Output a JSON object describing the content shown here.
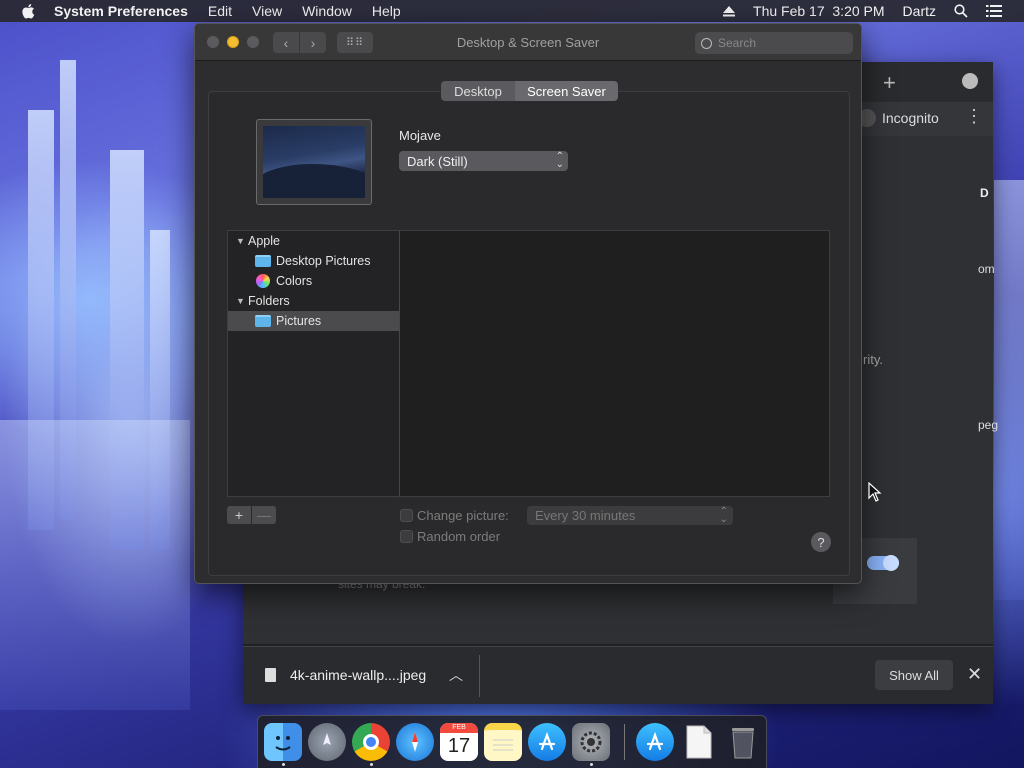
{
  "menubar": {
    "app_name": "System Preferences",
    "items": [
      "Edit",
      "View",
      "Window",
      "Help"
    ],
    "datetime": "Thu Feb 17  3:20 PM",
    "user": "Dartz"
  },
  "browser": {
    "profile_label": "Incognito",
    "cut_text_d": "D",
    "cut_text_com": "om",
    "cut_text_rity": "rity.",
    "cut_text_jpeg": "peg",
    "cut_text_sites": "sites may break.",
    "download": {
      "filename": "4k-anime-wallp....jpeg",
      "show_all": "Show All"
    }
  },
  "window": {
    "title": "Desktop & Screen Saver",
    "search_placeholder": "Search",
    "tabs": [
      {
        "label": "Desktop",
        "selected": true
      },
      {
        "label": "Screen Saver",
        "selected": false
      }
    ],
    "wallpaper_name": "Mojave",
    "wallpaper_mode": "Dark (Still)",
    "sources": {
      "group1": "Apple",
      "item1": "Desktop Pictures",
      "item2": "Colors",
      "group2": "Folders",
      "item3": "Pictures"
    },
    "change_picture_label": "Change picture:",
    "change_interval": "Every 30 minutes",
    "random_order_label": "Random order",
    "help": "?"
  },
  "dock": {
    "calendar_month": "FEB",
    "calendar_day": "17",
    "items": [
      "finder",
      "launchpad",
      "chrome",
      "safari",
      "calendar",
      "notes",
      "app-store",
      "system-preferences",
      "app-store-download",
      "document",
      "trash"
    ]
  },
  "colors": {
    "accent_toggle": "#8ab4f8",
    "minimize_yellow": "#f4bc2f",
    "folder_blue": "#5db5ea"
  }
}
